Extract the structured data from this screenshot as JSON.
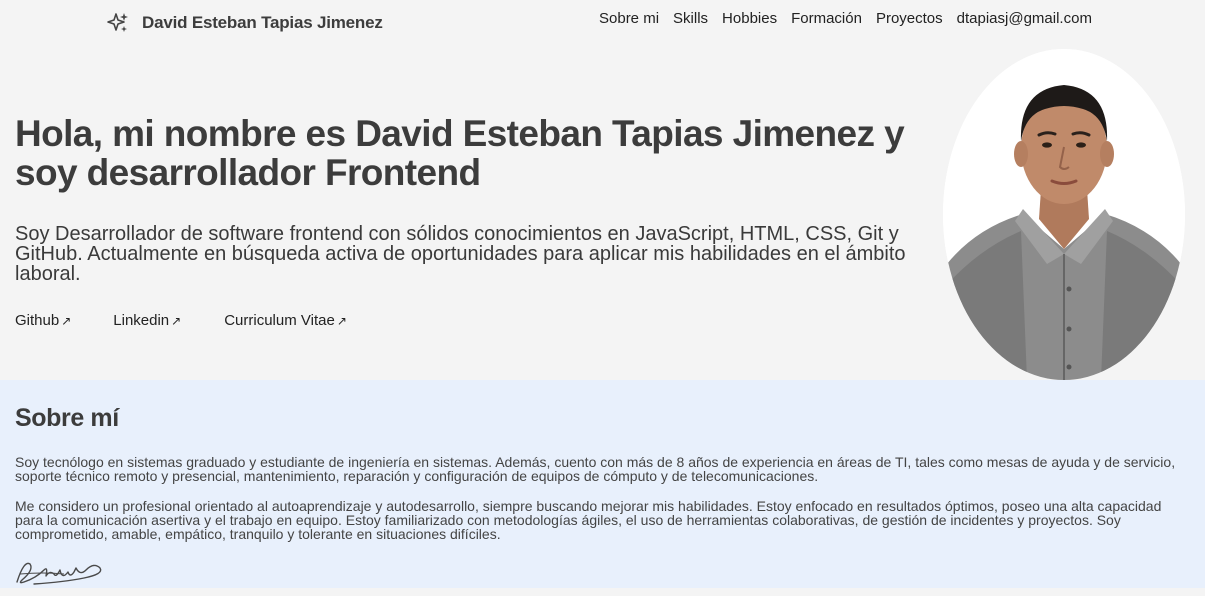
{
  "header": {
    "brand_icon": "sparkles-icon",
    "brand_name": "David Esteban Tapias Jimenez",
    "nav": {
      "about": "Sobre mi",
      "skills": "Skills",
      "hobbies": "Hobbies",
      "education": "Formación",
      "projects": "Proyectos",
      "email": "dtapiasj@gmail.com"
    }
  },
  "hero": {
    "title": "Hola, mi nombre es David Esteban Tapias Jimenez y soy desarrollador Frontend",
    "description": "Soy Desarrollador de software frontend con sólidos conocimientos en JavaScript, HTML, CSS, Git y GitHub. Actualmente en búsqueda activa de oportunidades para aplicar mis habilidades en el ámbito laboral.",
    "links": {
      "github": "Github",
      "linkedin": "Linkedin",
      "cv": "Curriculum Vitae",
      "arrow": "↗"
    }
  },
  "about": {
    "title": "Sobre mí",
    "paragraph1": "Soy tecnólogo en sistemas graduado y estudiante de ingeniería en sistemas. Además, cuento con más de 8 años de experiencia en áreas de TI, tales como mesas de ayuda y de servicio, soporte técnico remoto y presencial, mantenimiento, reparación y configuración de equipos de cómputo y de telecomunicaciones.",
    "paragraph2": "Me considero un profesional orientado al autoaprendizaje y autodesarrollo, siempre buscando mejorar mis habilidades. Estoy enfocado en resultados óptimos, poseo una alta capacidad para la comunicación asertiva y el trabajo en equipo. Estoy familiarizado con metodologías ágiles, el uso de herramientas colaborativas, de gestión de incidentes y proyectos. Soy comprometido, amable, empático, tranquilo y tolerante en situaciones difíciles.",
    "signature_icon": "signature-icon"
  },
  "colors": {
    "page_bg": "#f4f4f4",
    "about_bg": "#e8f0fc",
    "heading": "#3c3c3c"
  }
}
